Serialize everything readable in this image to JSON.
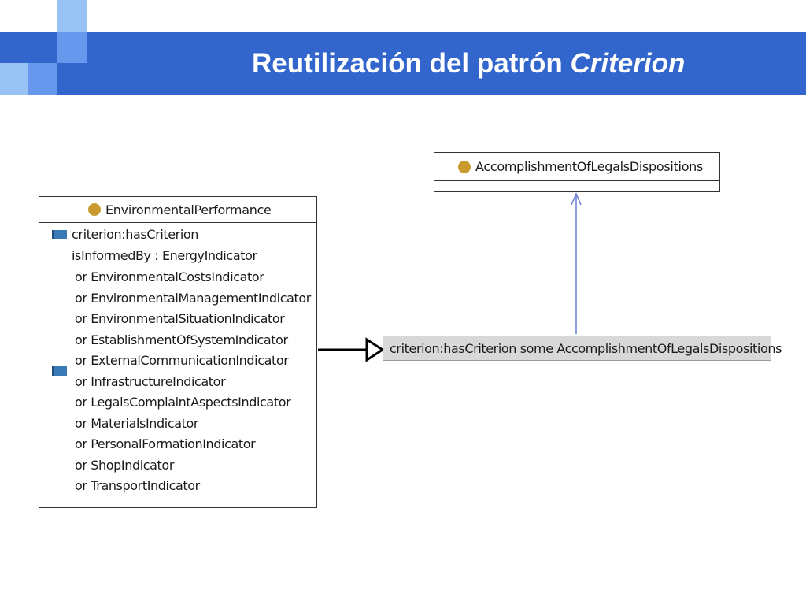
{
  "slide": {
    "title_main": "Reutilización del patrón ",
    "title_italic": "Criterion",
    "colors": {
      "header_blue": "#3366cc",
      "deco_light": "#99c2f5",
      "deco_mid": "#6699ee",
      "class_icon": "#c99a2e",
      "property_icon": "#3a7ab8",
      "arrow_blue": "#6a7bd6"
    }
  },
  "diagram": {
    "env_class": {
      "name": "EnvironmentalPerformance",
      "icon": "class-circle-icon",
      "rows": [
        "criterion:hasCriterion",
        "isInformedBy : EnergyIndicator",
        "or EnvironmentalCostsIndicator",
        "or EnvironmentalManagementIndicator",
        "or EnvironmentalSituationIndicator",
        "or EstablishmentOfSystemIndicator",
        "or ExternalCommunicationIndicator",
        "or InfrastructureIndicator",
        "or LegalsComplaintAspectsIndicator",
        "or MaterialsIndicator",
        "or PersonalFormationIndicator",
        "or ShopIndicator",
        "or TransportIndicator"
      ]
    },
    "acc_class": {
      "name": "AccomplishmentOfLegalsDispositions",
      "icon": "class-circle-icon"
    },
    "restriction": {
      "text": "criterion:hasCriterion some AccomplishmentOfLegalsDispositions"
    }
  }
}
